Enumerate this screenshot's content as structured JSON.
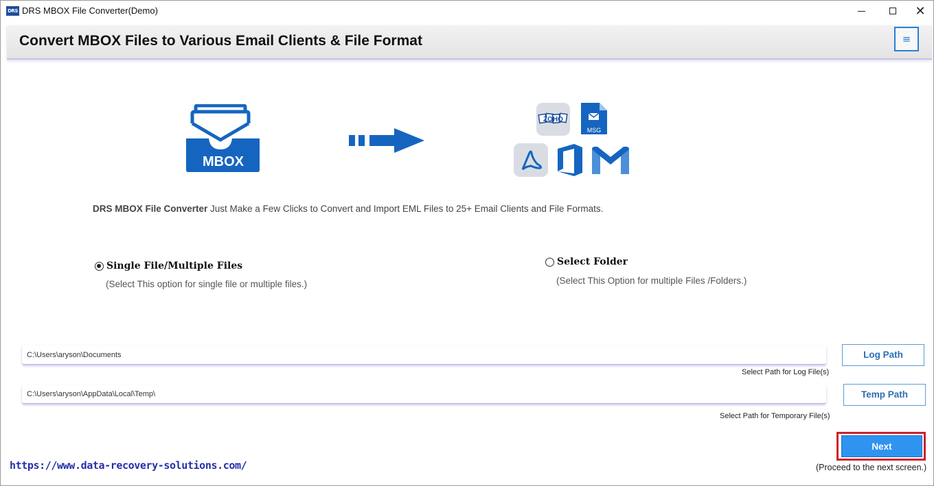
{
  "window": {
    "app_icon_text": "DRS",
    "title": "DRS MBOX File Converter(Demo)",
    "controls": [
      "minimize",
      "maximize",
      "close"
    ]
  },
  "header": {
    "title": "Convert MBOX Files to Various Email Clients & File Format",
    "menu_icon": "≡"
  },
  "illustration": {
    "source_label": "MBOX",
    "targets": [
      "ZOHO",
      "MSG",
      "PDF",
      "Office",
      "Gmail"
    ],
    "zoho_text": "ZOHO",
    "msg_text": "MSG"
  },
  "intro": {
    "product": "DRS MBOX File Converter",
    "text": " Just Make a Few Clicks to Convert and Import EML Files to 25+ Email Clients and File Formats."
  },
  "options": {
    "single": {
      "label": "Single File/Multiple Files",
      "hint": "(Select This option for single file or multiple files.)",
      "selected": true
    },
    "folder": {
      "label": "Select Folder",
      "hint": "(Select This Option for multiple Files /Folders.)",
      "selected": false
    }
  },
  "paths": {
    "log": {
      "value": "C:\\Users\\aryson\\Documents",
      "button": "Log Path",
      "note": "Select Path for Log File(s)"
    },
    "temp": {
      "value": "C:\\Users\\aryson\\AppData\\Local\\Temp\\",
      "button": "Temp Path",
      "note": "Select Path for Temporary File(s)"
    }
  },
  "footer": {
    "link": "https://www.data-recovery-solutions.com/",
    "next_button": "Next",
    "next_note": "(Proceed to the next screen.)"
  },
  "colors": {
    "brand_blue": "#1565c0",
    "button_blue": "#2f93f0",
    "highlight_red": "#d0202a",
    "link_blue": "#2530a8"
  }
}
